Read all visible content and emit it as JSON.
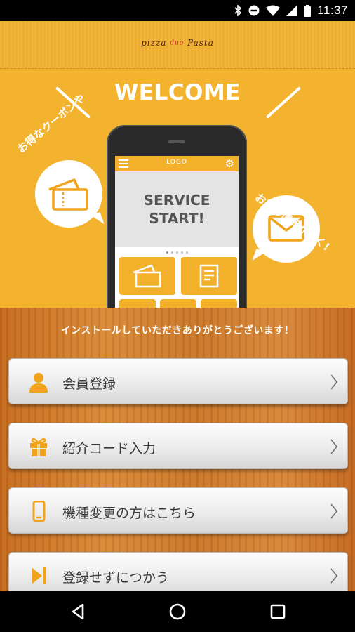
{
  "status_bar": {
    "time": "11:37"
  },
  "header": {
    "logo_main": "pizza",
    "logo_mid": "duo",
    "logo_end": "Pasta"
  },
  "hero": {
    "title": "WELCOME",
    "bubble_left_text": "お得なクーポンや",
    "bubble_right_text": "お店の情報が届く!",
    "phone": {
      "logo": "LOGO",
      "banner_line1": "SERVICE",
      "banner_line2": "START!"
    }
  },
  "main": {
    "thanks": "インストールしていただきありがとうございます！",
    "buttons": [
      {
        "label": "会員登録",
        "icon": "person-icon"
      },
      {
        "label": "紹介コード入力",
        "icon": "gift-icon"
      },
      {
        "label": "機種変更の方はこちら",
        "icon": "phone-icon"
      },
      {
        "label": "登録せずにつかう",
        "icon": "skip-icon"
      }
    ]
  },
  "colors": {
    "accent": "#f4b32e",
    "icon_orange": "#f0a41d"
  }
}
